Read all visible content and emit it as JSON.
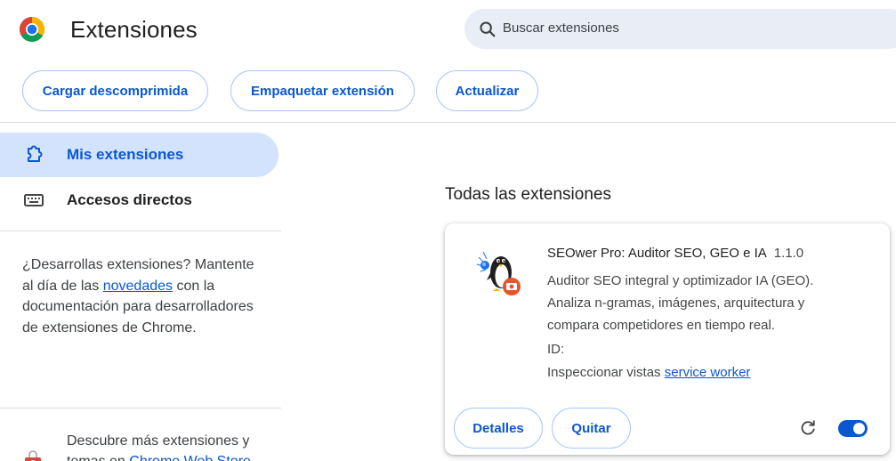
{
  "header": {
    "title": "Extensiones",
    "logo_icon": "chrome-logo",
    "search": {
      "placeholder": "Buscar extensiones",
      "icon": "search-icon"
    }
  },
  "toolbar": {
    "load_unpacked_label": "Cargar descomprimida",
    "pack_label": "Empaquetar extensión",
    "update_label": "Actualizar"
  },
  "sidebar": {
    "items": [
      {
        "label": "Mis extensiones",
        "icon": "puzzle-icon",
        "selected": true
      },
      {
        "label": "Accesos directos",
        "icon": "keyboard-icon",
        "selected": false
      }
    ],
    "dev": {
      "text_before": "¿Desarrollas extensiones? Mantente al día de las ",
      "link": "novedades",
      "text_after": " con la documentación para desarrolladores de extensiones de Chrome."
    },
    "store": {
      "text_before": "Descubre más extensiones y temas en ",
      "link": "Chrome Web Store",
      "icon": "web-store-icon"
    }
  },
  "main": {
    "section_title": "Todas las extensiones",
    "extension": {
      "name": "SEOwer Pro: Auditor SEO, GEO e IA",
      "version": "1.1.0",
      "description": "Auditor SEO integral y optimizador IA (GEO). Analiza n-gramas, imágenes, arquitectura y compara competidores en tiempo real.",
      "id_label": "ID:",
      "inspect_label": "Inspeccionar vistas",
      "inspect_link": "service worker",
      "details_label": "Detalles",
      "remove_label": "Quitar",
      "enabled": true,
      "icon": "penguin-extension-icon"
    }
  },
  "colors": {
    "accent": "#0b57d0",
    "selected_bg": "#d3e3fd",
    "search_bg": "#e9eef6",
    "button_border": "#a8c7fa"
  }
}
